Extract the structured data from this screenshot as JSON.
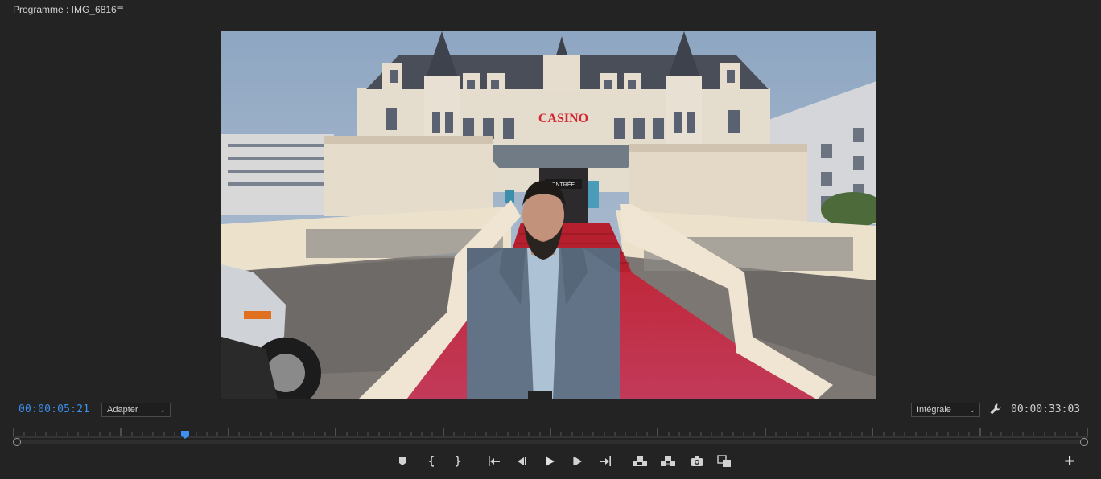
{
  "panel": {
    "title": "Programme : IMG_6816",
    "menu_icon": "hamburger-menu-icon"
  },
  "viewer": {
    "content": "program-monitor-frame",
    "sign_text": "CASINO",
    "entrance_text": "ENTRÉE"
  },
  "controls": {
    "current_time": "00:00:05:21",
    "zoom_level": "Adapter",
    "resolution": "Intégrale",
    "duration": "00:00:33:03",
    "settings_icon": "wrench-icon",
    "playhead_fraction": 0.16
  },
  "transport": {
    "buttons": [
      {
        "name": "add-marker-button",
        "icon": "marker-icon"
      },
      {
        "name": "mark-in-button",
        "icon": "mark-in-icon"
      },
      {
        "name": "mark-out-button",
        "icon": "mark-out-icon"
      },
      {
        "name": "go-to-in-button",
        "icon": "go-to-in-icon"
      },
      {
        "name": "step-back-button",
        "icon": "step-back-icon"
      },
      {
        "name": "play-button",
        "icon": "play-icon"
      },
      {
        "name": "step-forward-button",
        "icon": "step-forward-icon"
      },
      {
        "name": "go-to-out-button",
        "icon": "go-to-out-icon"
      },
      {
        "name": "lift-button",
        "icon": "lift-icon"
      },
      {
        "name": "extract-button",
        "icon": "extract-icon"
      },
      {
        "name": "export-frame-button",
        "icon": "camera-icon"
      },
      {
        "name": "comparison-view-button",
        "icon": "compare-icon"
      }
    ],
    "add_button_icon": "plus-icon"
  },
  "colors": {
    "background": "#232323",
    "accent_blue": "#3d8ff0",
    "text": "#cfcfcf"
  }
}
